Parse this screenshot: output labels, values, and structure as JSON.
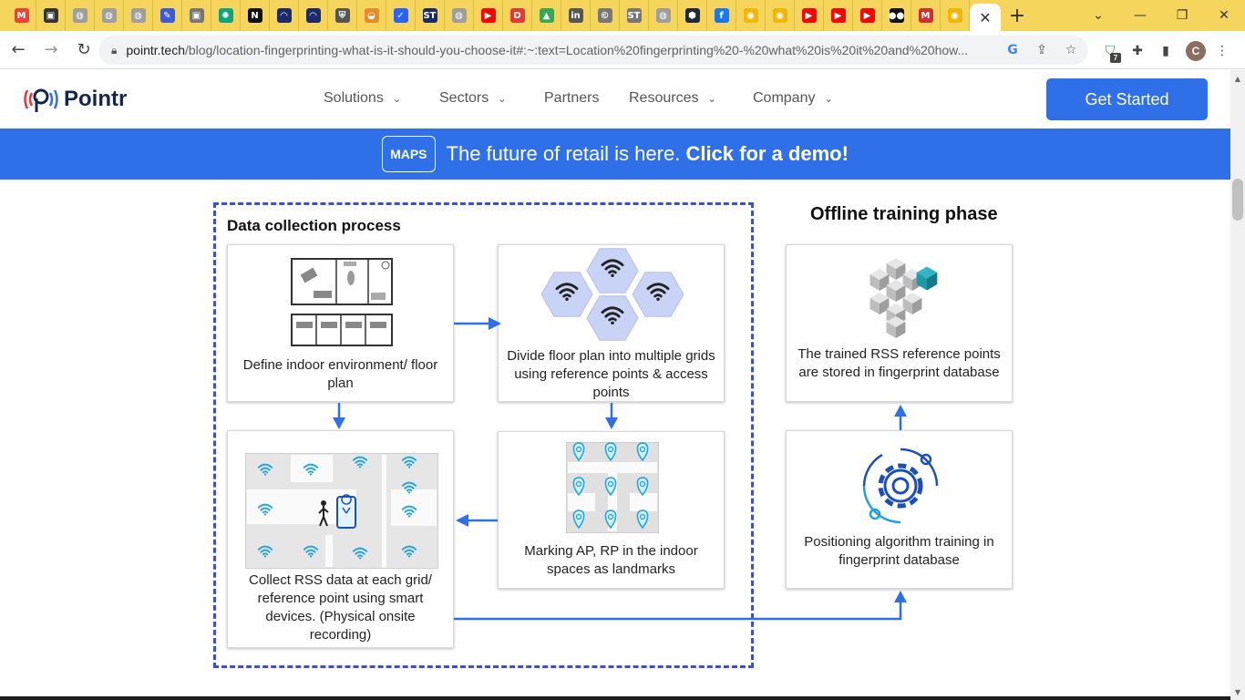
{
  "browser": {
    "tabs": [
      {
        "icon": "gmail-icon",
        "color": "#ea4335",
        "glyph": "M"
      },
      {
        "icon": "contacts-icon",
        "color": "#333333",
        "glyph": "▣"
      },
      {
        "icon": "globe-icon",
        "color": "#9e9e9e",
        "glyph": "◍"
      },
      {
        "icon": "globe-icon",
        "color": "#9e9e9e",
        "glyph": "◍"
      },
      {
        "icon": "globe-icon",
        "color": "#9e9e9e",
        "glyph": "◍"
      },
      {
        "icon": "pen-icon",
        "color": "#3b5bdb",
        "glyph": "✎"
      },
      {
        "icon": "person-icon",
        "color": "#777777",
        "glyph": "▣"
      },
      {
        "icon": "chatgpt-icon",
        "color": "#10a37f",
        "glyph": "✺"
      },
      {
        "icon": "notion-icon",
        "color": "#111111",
        "glyph": "N"
      },
      {
        "icon": "gauge-icon",
        "color": "#1a2a6c",
        "glyph": "◠"
      },
      {
        "icon": "gauge-icon",
        "color": "#1a2a6c",
        "glyph": "◠"
      },
      {
        "icon": "shield-icon",
        "color": "#555555",
        "glyph": "⛨"
      },
      {
        "icon": "rainbow-icon",
        "color": "#e58b2a",
        "glyph": "◒"
      },
      {
        "icon": "check-icon",
        "color": "#2962ff",
        "glyph": "✓"
      },
      {
        "icon": "st-icon",
        "color": "#1b2a6b",
        "glyph": "ST"
      },
      {
        "icon": "globe-icon",
        "color": "#9e9e9e",
        "glyph": "◍"
      },
      {
        "icon": "youtube-icon",
        "color": "#ff0000",
        "glyph": "▶"
      },
      {
        "icon": "d-icon",
        "color": "#e53935",
        "glyph": "D"
      },
      {
        "icon": "drive-icon",
        "color": "#34a853",
        "glyph": "▲"
      },
      {
        "icon": "linkedin-icon",
        "color": "#555555",
        "glyph": "in"
      },
      {
        "icon": "c-circle-icon",
        "color": "#777777",
        "glyph": "©"
      },
      {
        "icon": "st-icon",
        "color": "#777777",
        "glyph": "ST"
      },
      {
        "icon": "globe-icon",
        "color": "#9e9e9e",
        "glyph": "◍"
      },
      {
        "icon": "hex-icon",
        "color": "#1e2a3a",
        "glyph": "⬢"
      },
      {
        "icon": "facebook-icon",
        "color": "#1877f2",
        "glyph": "f"
      },
      {
        "icon": "github-icon",
        "color": "#f2b705",
        "glyph": "◉"
      },
      {
        "icon": "github-icon",
        "color": "#f2b705",
        "glyph": "◉"
      },
      {
        "icon": "youtube-icon",
        "color": "#ff0000",
        "glyph": "▶"
      },
      {
        "icon": "youtube-icon",
        "color": "#ff0000",
        "glyph": "▶"
      },
      {
        "icon": "youtube-icon",
        "color": "#ff0000",
        "glyph": "▶"
      },
      {
        "icon": "medium-icon",
        "color": "#111111",
        "glyph": "●●"
      },
      {
        "icon": "m-icon",
        "color": "#d32f2f",
        "glyph": "M"
      },
      {
        "icon": "github-icon",
        "color": "#f2b705",
        "glyph": "◉"
      }
    ],
    "active_tab_close": "✕",
    "new_tab": "+",
    "url_host": "pointr.tech",
    "url_rest": "/blog/location-fingerprinting-what-is-it-should-you-choose-it#:~:text=Location%20fingerprinting%20-%20what%20is%20it%20and%20how...",
    "profile_initial": "C",
    "extension_badge": "7"
  },
  "site": {
    "logo_text": "Pointr",
    "nav": [
      {
        "label": "Solutions",
        "has_menu": true
      },
      {
        "label": "Sectors",
        "has_menu": true
      },
      {
        "label": "Partners",
        "has_menu": false
      },
      {
        "label": "Resources",
        "has_menu": true
      },
      {
        "label": "Company",
        "has_menu": true
      }
    ],
    "cta_label": "Get Started",
    "banner": {
      "badge": "MAPS",
      "text": "The future of retail is here.",
      "link": "Click for a demo!"
    }
  },
  "diagram": {
    "left_title": "Data collection process",
    "right_title": "Offline training phase",
    "cards": {
      "define": "Define indoor environment/ floor plan",
      "divide": "Divide floor plan into multiple grids using reference points & access points",
      "marking": "Marking AP, RP in the indoor spaces as landmarks",
      "collect": "Collect RSS data at each grid/ reference point using smart devices. (Physical onsite recording)",
      "stored": "The trained RSS reference points are stored in fingerprint database",
      "training": "Positioning algorithm training in fingerprint database"
    },
    "colors": {
      "arrow": "#2f6fe8",
      "dashed_border": "#3f4fc8",
      "hex_fill": "#c9d3f5",
      "wifi": "#1fa3d8",
      "gear": "#1d4fb8",
      "cube_teal": "#1f9aa8",
      "cube_grey": "#bdbdbd"
    }
  }
}
